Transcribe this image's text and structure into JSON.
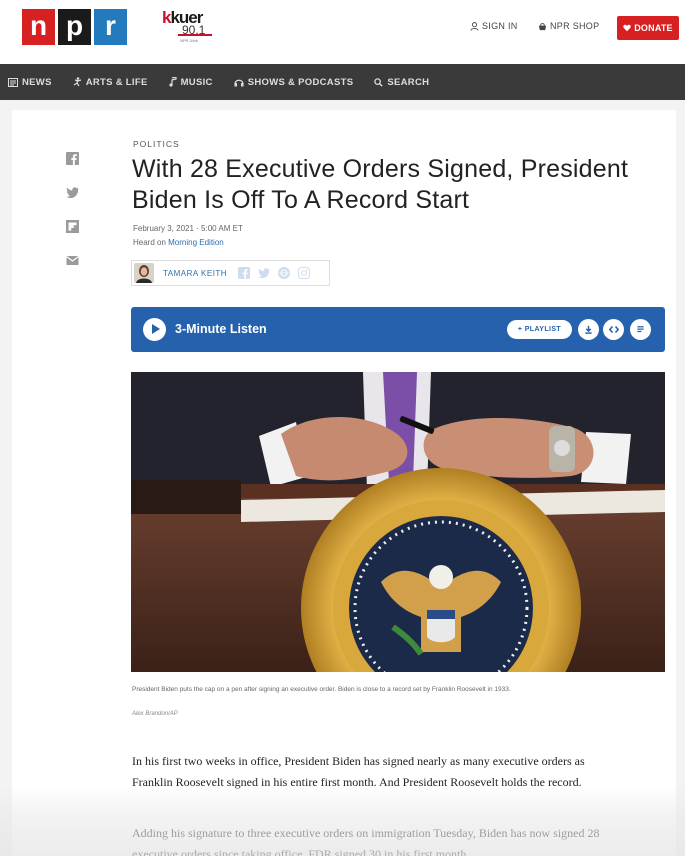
{
  "header": {
    "logo_letters": [
      "n",
      "p",
      "r"
    ],
    "station": {
      "name": "kuer",
      "frequency": "90.1",
      "tagline": "NPR Utah"
    },
    "sign_in": "SIGN IN",
    "shop": "NPR SHOP",
    "donate": "DONATE"
  },
  "nav": {
    "items": [
      {
        "label": "NEWS",
        "icon": "news-icon"
      },
      {
        "label": "ARTS & LIFE",
        "icon": "arts-icon"
      },
      {
        "label": "MUSIC",
        "icon": "music-note-icon"
      },
      {
        "label": "SHOWS & PODCASTS",
        "icon": "headphones-icon"
      },
      {
        "label": "SEARCH",
        "icon": "search-icon"
      }
    ]
  },
  "share": {
    "icons": [
      "facebook-icon",
      "twitter-icon",
      "flipboard-icon",
      "email-icon"
    ]
  },
  "article": {
    "slug": "POLITICS",
    "headline": "With 28 Executive Orders Signed, President Biden Is Off To A Record Start",
    "date": "February 3, 2021 · 5:00 AM ET",
    "heard_on_prefix": "Heard on ",
    "heard_on_show": "Morning Edition",
    "author": "TAMARA KEITH",
    "author_social": [
      "facebook-icon",
      "twitter-icon",
      "globe-icon",
      "instagram-icon"
    ],
    "photo_caption": "President Biden puts the cap on a pen after signing an executive order. Biden is close to a record set by Franklin Roosevelt in 1933.",
    "photo_credit": "Alex Brandon/AP",
    "paragraphs": [
      "In his first two weeks in office, President Biden has signed nearly as many executive orders as Franklin Roosevelt signed in his entire first month. And President Roosevelt holds the record.",
      "Adding his signature to three executive orders on immigration Tuesday, Biden has now signed 28 executive orders since taking office. FDR signed 30 in his first month."
    ]
  },
  "player": {
    "title": "3-Minute Listen",
    "playlist": "+ PLAYLIST",
    "actions": [
      "download-icon",
      "embed-icon",
      "transcript-icon"
    ]
  },
  "colors": {
    "npr_red": "#d62021",
    "npr_blue": "#237bbd",
    "player_blue": "#2561ad",
    "nav_bg": "#3a3a3a",
    "link_blue": "#2b6fae"
  }
}
